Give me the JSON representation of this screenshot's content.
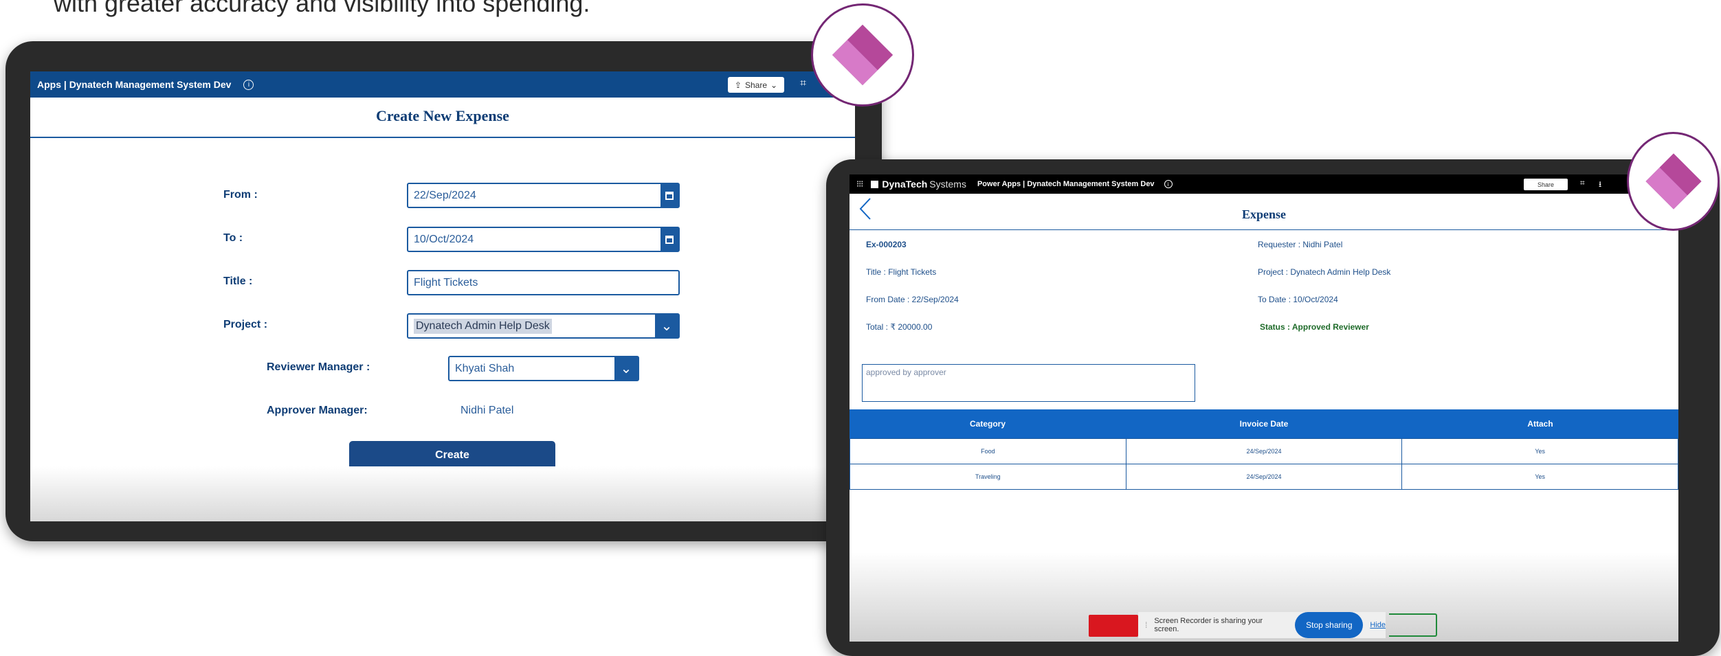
{
  "caption": "with greater accuracy and visibility into spending.",
  "create_screen": {
    "app_title": "Apps | Dynatech Management System Dev",
    "share_label": "Share",
    "page_title": "Create New Expense",
    "form": {
      "from_label": "From :",
      "from_value": "22/Sep/2024",
      "to_label": "To :",
      "to_value": "10/Oct/2024",
      "title_label": "Title :",
      "title_value": "Flight Tickets",
      "project_label": "Project :",
      "project_value": "Dynatech Admin Help Desk",
      "reviewer_label": "Reviewer Manager :",
      "reviewer_value": "Khyati Shah",
      "approver_label": "Approver Manager:",
      "approver_value": "Nidhi Patel"
    },
    "create_label": "Create"
  },
  "detail_screen": {
    "brand": "DynaTech",
    "brand_sub": "Systems",
    "app_title": "Power Apps | Dynatech Management System Dev",
    "share_label": "Share",
    "page_title": "Expense",
    "expense_id": "Ex-000203",
    "requester": "Requester : Nidhi Patel",
    "title": "Title : Flight Tickets",
    "project": "Project : Dynatech Admin Help Desk",
    "from_date": "From Date : 22/Sep/2024",
    "to_date": "To Date : 10/Oct/2024",
    "total": "Total : ₹ 20000.00",
    "status": "Status : Approved Reviewer",
    "comment": "approved by approver",
    "table": {
      "headers": [
        "Category",
        "Invoice Date",
        "Attach"
      ],
      "rows": [
        [
          "Food",
          "24/Sep/2024",
          "Yes"
        ],
        [
          "Traveling",
          "24/Sep/2024",
          "Yes"
        ]
      ]
    },
    "screen_share": {
      "message": "Screen Recorder is sharing your screen.",
      "stop_label": "Stop sharing",
      "hide_label": "Hide"
    }
  },
  "colors": {
    "app_blue": "#0f4a8a",
    "table_header_blue": "#1266c4",
    "status_green": "#1f6b2a",
    "logo_purple": "#742774"
  },
  "icons": [
    "calendar-icon",
    "chevron-down-icon",
    "info-icon",
    "share-icon",
    "waffle-icon",
    "back-chevron-icon",
    "power-apps-logo"
  ]
}
